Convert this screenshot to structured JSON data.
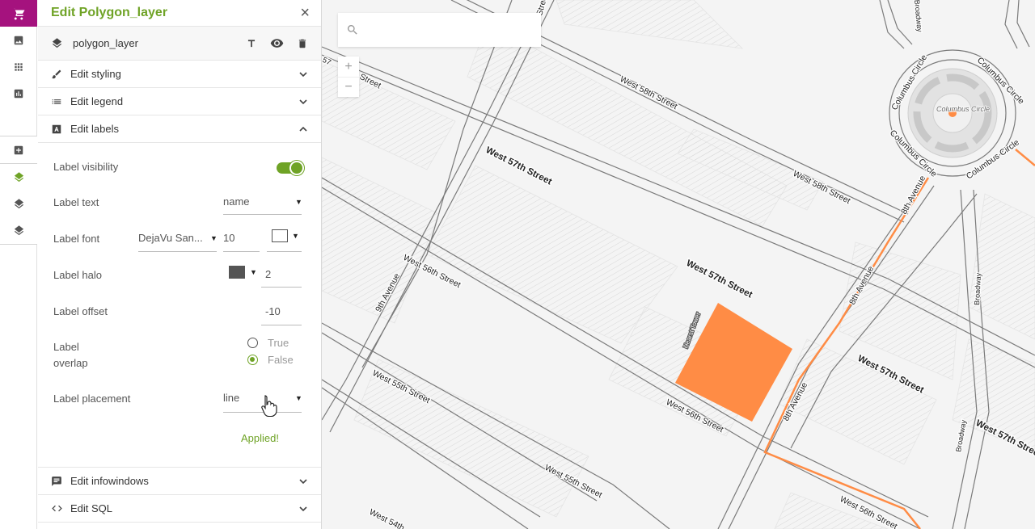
{
  "panel": {
    "title": "Edit Polygon_layer",
    "close": "×",
    "layer_name": "polygon_layer"
  },
  "sections": {
    "styling": "Edit styling",
    "legend": "Edit legend",
    "labels": "Edit labels",
    "infowindows": "Edit infowindows",
    "sql": "Edit SQL"
  },
  "labels_form": {
    "visibility_label": "Label visibility",
    "text_label": "Label text",
    "text_value": "name",
    "font_label": "Label font",
    "font_value": "DejaVu San...",
    "font_size": "10",
    "font_color": "#ffffff",
    "halo_label": "Label halo",
    "halo_color": "#555555",
    "halo_size": "2",
    "offset_label": "Label offset",
    "offset_value": "-10",
    "overlap_label_1": "Label",
    "overlap_label_2": "overlap",
    "overlap_true": "True",
    "overlap_false": "False",
    "placement_label": "Label placement",
    "placement_value": "line",
    "applied": "Applied!"
  },
  "map": {
    "streets": {
      "w58_a": "West 58th Street",
      "w58_b": "West 58th Street",
      "w57_a": "West 57th Street",
      "w57_b": "West 57th Street",
      "w57_c": "West 57th Street",
      "w57_d": "West 57th Street",
      "w56_a": "West 56th Street",
      "w56_b": "West 56th Street",
      "w56_c": "West 56th Street",
      "w55_a": "West 55th Street",
      "w55_b": "West 55th Street",
      "w54": "West 54th",
      "ave9": "9th Avenue",
      "ave8_a": "8th Avenue",
      "ave8_b": "8th Avenue",
      "ave8_c": "8th Avenue",
      "broadway_a": "Broadway",
      "broadway_b": "Broadway",
      "broadway_c": "Broadway",
      "cc1": "Columbus Circle",
      "cc2": "Columbus Circle",
      "cc3": "Columbus Circle",
      "cc4": "Columbus Circle",
      "cc_center": "Columbus Circle",
      "frag_57": "57",
      "frag_set": "Street",
      "frag_top": "Street"
    },
    "poi_label": "Hearst Tower",
    "accent": "#ff8c45"
  },
  "colors": {
    "brand": "#a5127e",
    "accent_green": "#6fa326"
  }
}
